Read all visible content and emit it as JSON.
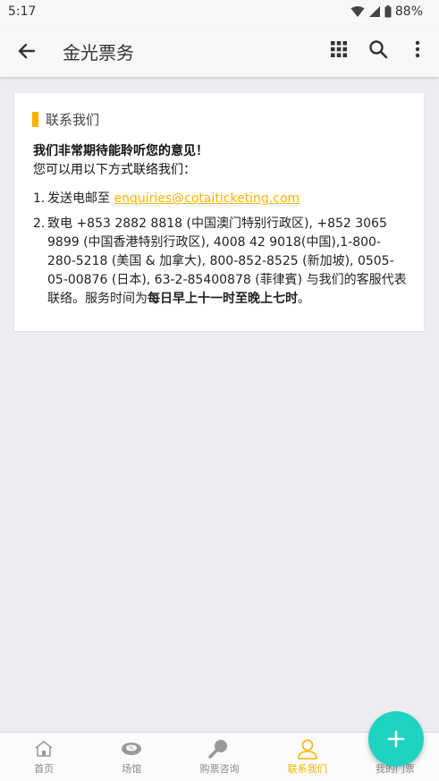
{
  "status_bar": {
    "time": "5:17",
    "battery": "88%"
  },
  "app_bar": {
    "title": "金光票务"
  },
  "card": {
    "title": "联系我们",
    "intro_bold": "我们非常期待能聆听您的意见！",
    "intro": "您可以用以下方式联络我们：",
    "items": [
      {
        "num": "1.",
        "prefix": "发送电邮至 ",
        "email": "enquiries@cotaiticketing.com"
      },
      {
        "num": "2.",
        "text": "致电 +853 2882 8818 (中国澳门特别行政区), +852 3065 9899 (中国香港特别行政区), 4008 42 9018(中国),1-800-280-5218 (美国 & 加拿大), 800-852-8525 (新加坡), 0505-05-00876 (日本), 63-2-85400878 (菲律賓) 与我们的客服代表联络。服务时间为",
        "bold": "每日早上十一时至晚上七时",
        "suffix": "。"
      }
    ]
  },
  "bottom_nav": {
    "items": [
      {
        "label": "首页",
        "icon": "home-icon",
        "active": false
      },
      {
        "label": "场馆",
        "icon": "venue-icon",
        "active": false
      },
      {
        "label": "购票咨询",
        "icon": "ticket-enquiry-icon",
        "active": false
      },
      {
        "label": "联系我们",
        "icon": "contact-icon",
        "active": true
      },
      {
        "label": "我的门票",
        "icon": "my-tickets-icon",
        "active": false
      }
    ]
  },
  "colors": {
    "accent": "#f5b400",
    "fab": "#1fd3c3",
    "background": "#ededf1"
  }
}
